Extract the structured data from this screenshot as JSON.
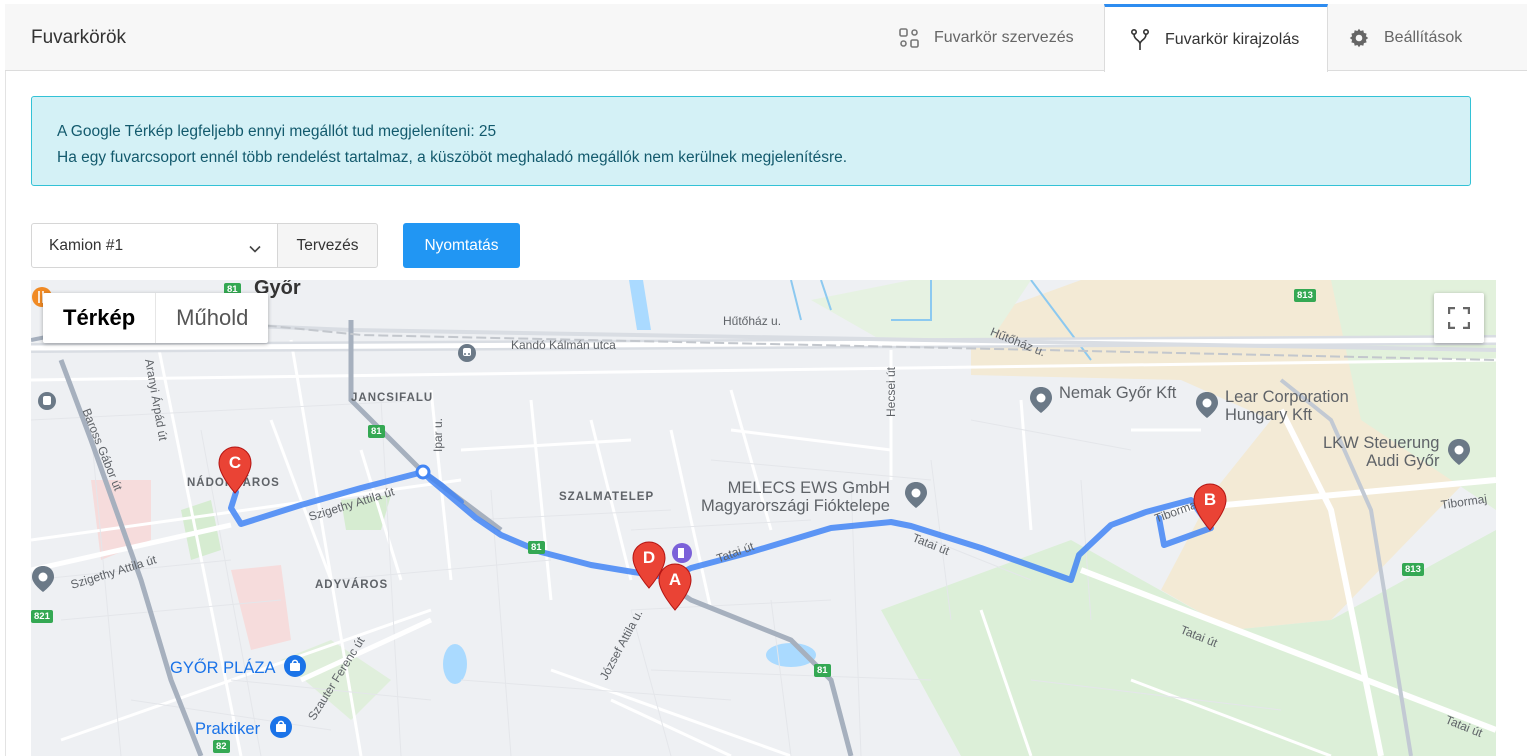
{
  "header": {
    "title": "Fuvarkörök",
    "tabs": [
      {
        "label": "Fuvarkör szervezés",
        "icon": "route-grid-icon",
        "active": false
      },
      {
        "label": "Fuvarkör kirajzolás",
        "icon": "fork-route-icon",
        "active": true
      },
      {
        "label": "Beállítások",
        "icon": "gear-icon",
        "active": false
      }
    ]
  },
  "alert": {
    "line1": "A Google Térkép legfeljebb ennyi megállót tud megjeleníteni: 25",
    "line2": "Ha egy fuvarcsoport ennél több rendelést tartalmaz, a küszöböt meghaladó megállók nem kerülnek megjelenítésre."
  },
  "controls": {
    "vehicle_selected": "Kamion #1",
    "plan_label": "Tervezés",
    "print_label": "Nyomtatás"
  },
  "map": {
    "type_options": [
      "Térkép",
      "Műhold"
    ],
    "selected_type": "Térkép",
    "city": "Győr",
    "areas": [
      "JANCSIFALU",
      "NÁDORVÁROS",
      "SZALMATELEP",
      "ADYVÁROS"
    ],
    "streets": [
      "Hűtőház u.",
      "Hűtőház u.",
      "Kandó Kálmán utca",
      "Hecsei út",
      "Ipar u.",
      "Szigethy Attila út",
      "Szigethy Attila út",
      "Baross Gábor út",
      "Aranyi Árpád út",
      "Tatai út",
      "Tatai út",
      "Tatai út",
      "Tatai út",
      "József Attila u.",
      "Szauter Ferenc út",
      "Tiborma utca",
      "Tibormaj"
    ],
    "pois": [
      {
        "name": "Nemak Győr Kft",
        "style": "gray"
      },
      {
        "name": "Lear Corporation\nHungary Kft",
        "style": "gray"
      },
      {
        "name": "LKW Steuerung\nAudi Győr",
        "style": "gray"
      },
      {
        "name": "MELECS EWS GmbH\nMagyarországi Fióktelepe",
        "style": "gray"
      },
      {
        "name": "GYŐR PLÁZA",
        "style": "blue"
      },
      {
        "name": "Praktiker",
        "style": "blue"
      }
    ],
    "road_shields": [
      "81",
      "81",
      "81",
      "81",
      "813",
      "813",
      "821",
      "82"
    ],
    "markers": [
      "A",
      "B",
      "C",
      "D"
    ],
    "colors": {
      "route": "#4285f4",
      "marker": "#ea4335",
      "park": "#cfe9cf",
      "industrial": "#f3ead5"
    }
  }
}
